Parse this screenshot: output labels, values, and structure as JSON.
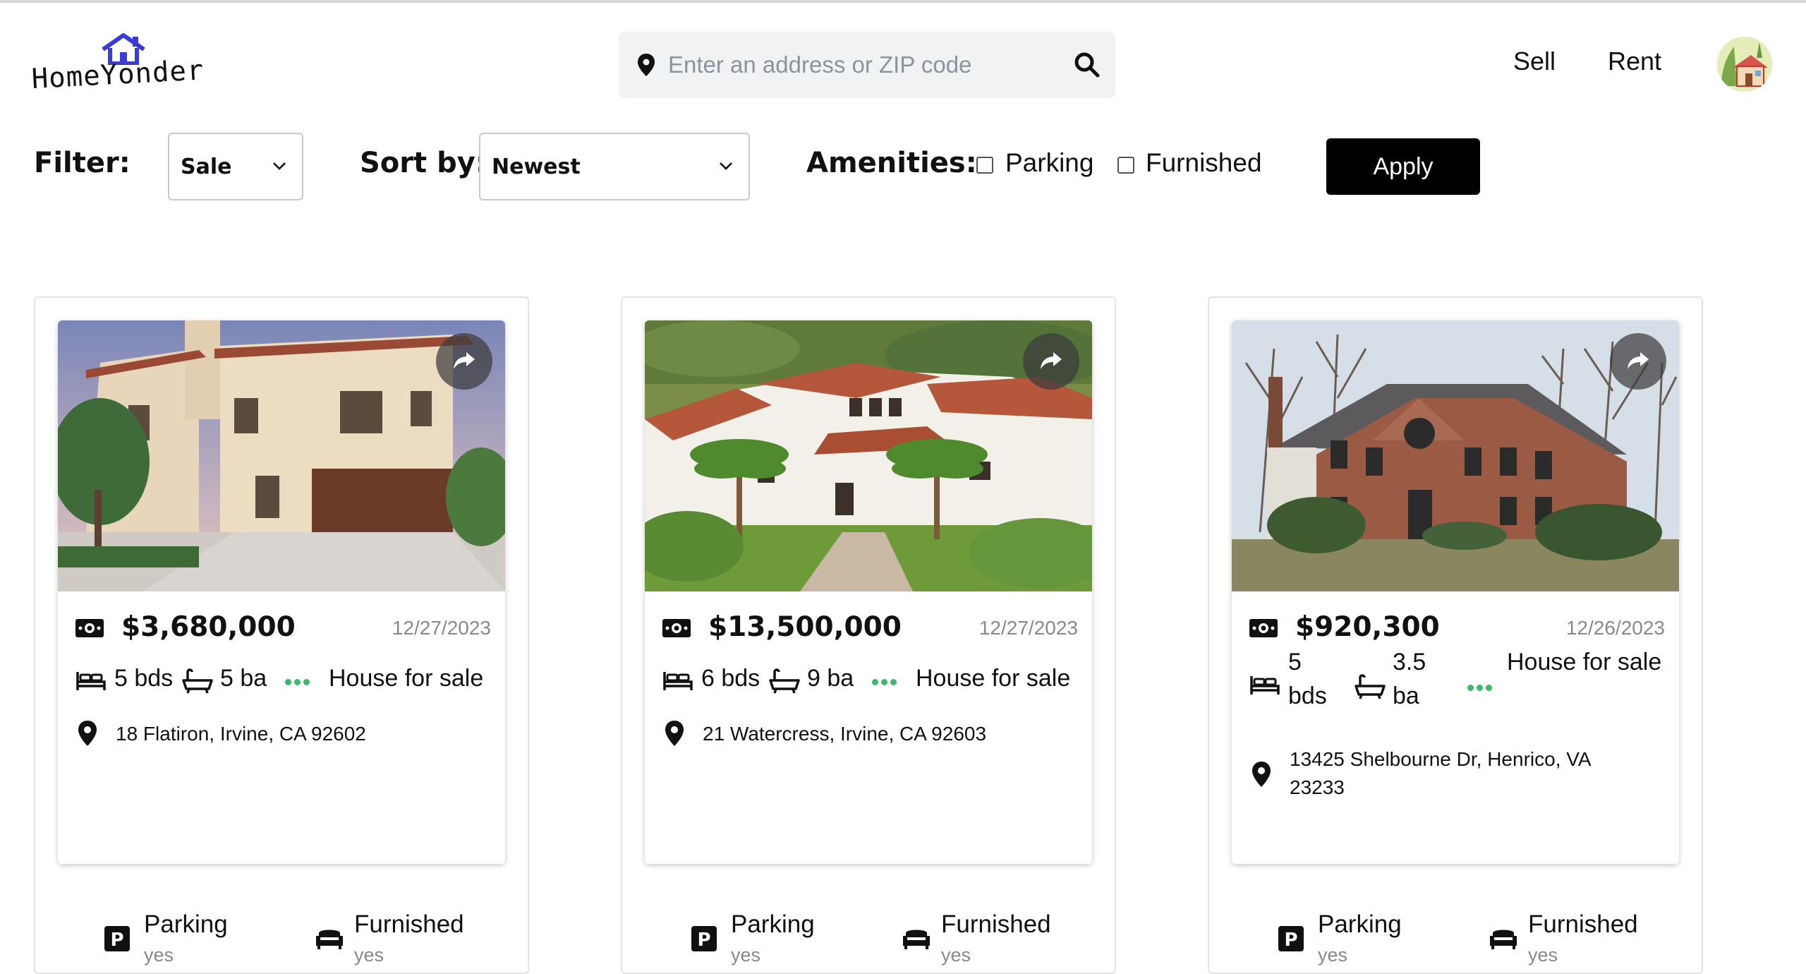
{
  "app": {
    "logo_text": "HomeYonder"
  },
  "search": {
    "placeholder": "Enter an address or ZIP code",
    "value": ""
  },
  "nav": {
    "sell": "Sell",
    "rent": "Rent"
  },
  "filters": {
    "filter_label": "Filter:",
    "filter_value": "Sale",
    "sort_label": "Sort by:",
    "sort_value": "Newest",
    "amenities_label": "Amenities:",
    "parking_label": "Parking",
    "parking_checked": false,
    "furnished_label": "Furnished",
    "furnished_checked": false,
    "apply_label": "Apply"
  },
  "listings": [
    {
      "price": "$3,680,000",
      "date": "12/27/2023",
      "beds": "5 bds",
      "baths": "5 ba",
      "status": "House for sale",
      "address": "18 Flatiron, Irvine, CA 92602",
      "amenities": {
        "parking_label": "Parking",
        "parking_value": "yes",
        "furnished_label": "Furnished",
        "furnished_value": "yes"
      }
    },
    {
      "price": "$13,500,000",
      "date": "12/27/2023",
      "beds": "6 bds",
      "baths": "9 ba",
      "status": "House for sale",
      "address": "21 Watercress, Irvine, CA 92603",
      "amenities": {
        "parking_label": "Parking",
        "parking_value": "yes",
        "furnished_label": "Furnished",
        "furnished_value": "yes"
      }
    },
    {
      "price": "$920,300",
      "date": "12/26/2023",
      "beds": "5 bds",
      "baths": "3.5 ba",
      "status": "House for sale",
      "address": "13425 Shelbourne Dr, Henrico, VA 23233",
      "amenities": {
        "parking_label": "Parking",
        "parking_value": "yes",
        "furnished_label": "Furnished",
        "furnished_value": "yes"
      }
    }
  ],
  "colors": {
    "accent": "#000000",
    "logo_roof": "#3b3bd6",
    "dots": "#3cb869",
    "date": "#8a8a8a"
  }
}
